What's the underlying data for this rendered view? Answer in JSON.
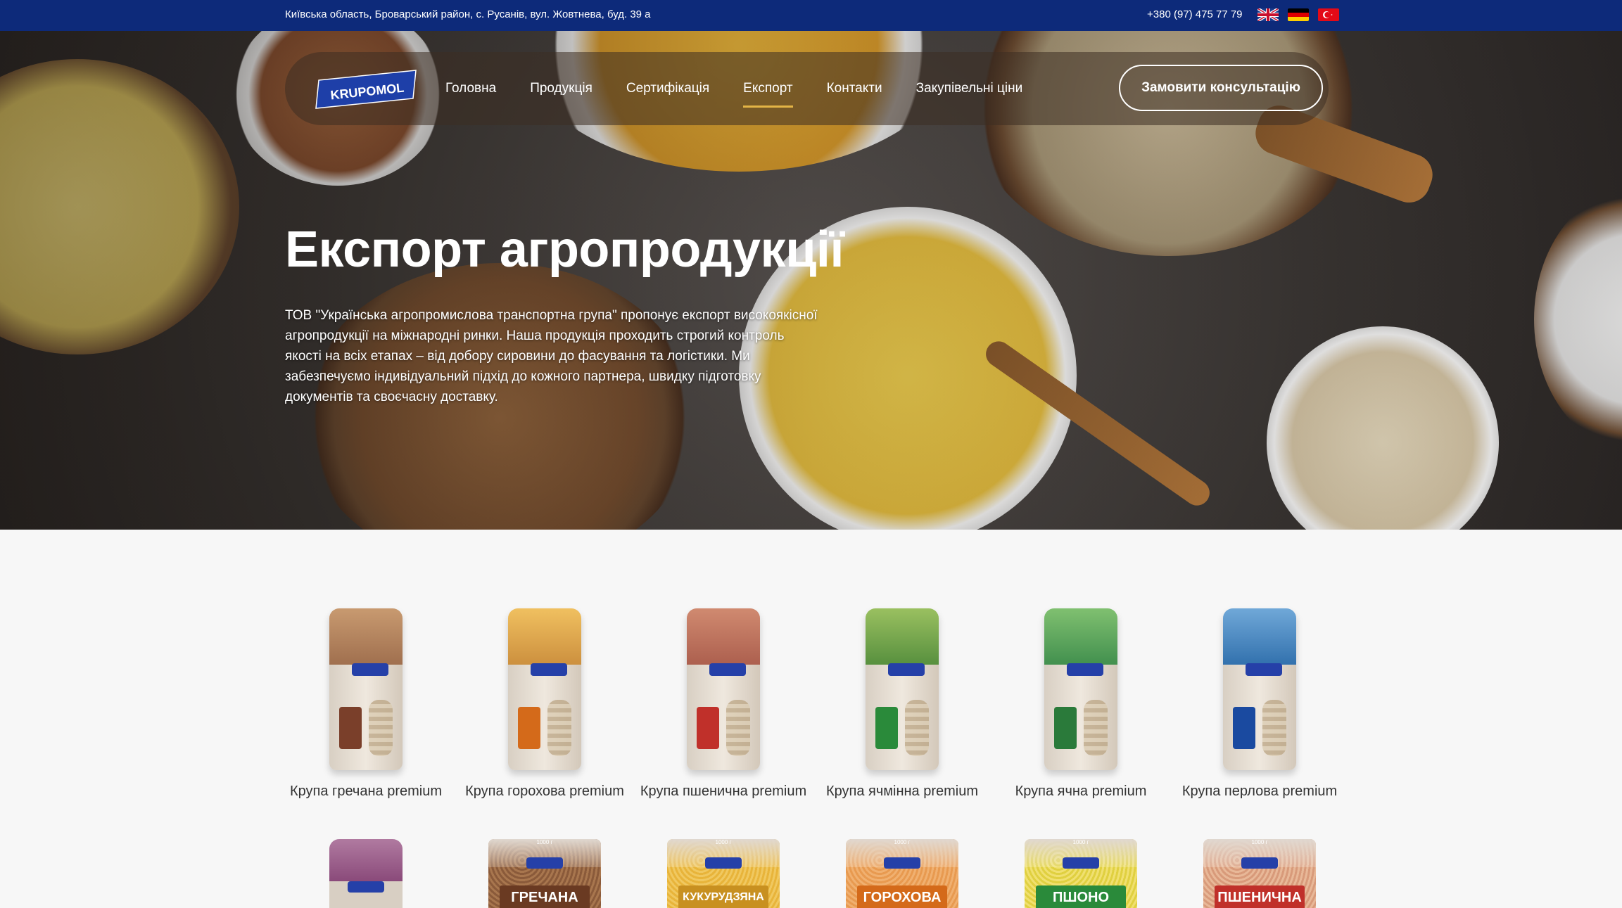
{
  "topbar": {
    "address": "Київська область, Броварський район, с. Русанів, вул. Жовтнева, буд. 39 а",
    "phone": "+380 (97) 475 77 79",
    "languages": [
      {
        "name": "english-flag-icon"
      },
      {
        "name": "german-flag-icon"
      },
      {
        "name": "turkish-flag-icon"
      }
    ]
  },
  "nav": {
    "logo_text": "KRUPOMOL",
    "items": [
      {
        "label": "Головна"
      },
      {
        "label": "Продукція"
      },
      {
        "label": "Сертифікація"
      },
      {
        "label": "Експорт",
        "active": true
      },
      {
        "label": "Контакти"
      },
      {
        "label": "Закупівельні ціни"
      }
    ],
    "cta_label": "Замовити консультацію"
  },
  "hero": {
    "title": "Експорт агропродукції",
    "text": "ТОВ \"Українська агропромислова транспортна група\" пропонує експорт високоякісної агропродукції на міжнародні ринки. Наша продукція проходить строгий контроль якості на всіх етапах – від добору сировини до фасування та логістики. Ми забезпечуємо індивідуальний підхід до кожного партнера, швидку підготовку документів та своєчасну доставку."
  },
  "products": [
    {
      "name": "Крупа гречана premium",
      "top_color": "#9b6a4a",
      "label_color": "#7a3f2a"
    },
    {
      "name": "Крупа горохова premium",
      "top_color": "#c88a3a",
      "label_color": "#d46a1a"
    },
    {
      "name": "Крупа пшенична premium",
      "top_color": "#a85a4a",
      "label_color": "#c0302a"
    },
    {
      "name": "Крупа ячмінна premium",
      "top_color": "#4f8a3a",
      "label_color": "#2a8a3a"
    },
    {
      "name": "Крупа ячна premium",
      "top_color": "#3a8a4a",
      "label_color": "#2a7a3a"
    },
    {
      "name": "Крупа перлова premium",
      "top_color": "#2a6aa8",
      "label_color": "#1a4aa0"
    }
  ],
  "products_row2": [
    {
      "label": "",
      "top_color": "#8a4a7a"
    },
    {
      "label": "ГРЕЧАНА",
      "top_color": "#8a5a3a",
      "weight": "1000 г"
    },
    {
      "label": "КУКУРУДЗЯНА",
      "top_color": "#d8a030",
      "weight": "1000 г"
    },
    {
      "label": "ГОРОХОВА",
      "top_color": "#d88a40",
      "weight": "1000 г"
    },
    {
      "label": "ПШОНО",
      "top_color": "#d0c040",
      "weight": "1000 г"
    },
    {
      "label": "ПШЕНИЧНА",
      "top_color": "#b0603a",
      "weight": "1000 г"
    }
  ]
}
